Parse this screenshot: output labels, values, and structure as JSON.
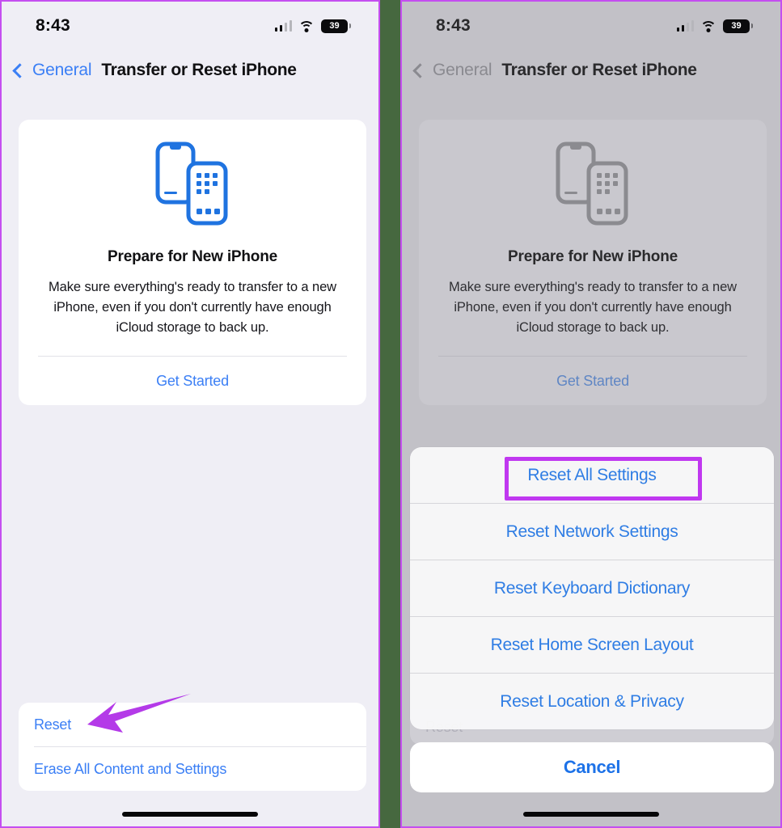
{
  "meta": {
    "accent_blue": "#3b7ff5",
    "annotation_purple": "#c038f0",
    "panel_bg": "#efeef5",
    "panel_bg_dimmed": "#c2c1c7",
    "gutter_green": "#46683f"
  },
  "status_bar": {
    "time": "8:43",
    "battery_percent": "39",
    "cellular_icon": "cellular-bars-icon",
    "wifi_icon": "wifi-icon",
    "battery_icon": "battery-icon"
  },
  "nav": {
    "back_icon": "chevron-left-icon",
    "back_label": "General",
    "title": "Transfer or Reset iPhone"
  },
  "prepare_card": {
    "icon": "two-phones-transfer-icon",
    "title": "Prepare for New iPhone",
    "description": "Make sure everything's ready to transfer to a new iPhone, even if you don't currently have enough iCloud storage to back up.",
    "action_label": "Get Started"
  },
  "bottom_list": {
    "items": [
      {
        "label": "Reset"
      },
      {
        "label": "Erase All Content and Settings"
      }
    ]
  },
  "action_sheet": {
    "items": [
      {
        "label": "Reset All Settings",
        "highlighted": true
      },
      {
        "label": "Reset Network Settings",
        "highlighted": false
      },
      {
        "label": "Reset Keyboard Dictionary",
        "highlighted": false
      },
      {
        "label": "Reset Home Screen Layout",
        "highlighted": false
      },
      {
        "label": "Reset Location & Privacy",
        "highlighted": false
      }
    ],
    "cancel_label": "Cancel",
    "ghost_label": "Reset"
  },
  "annotations": {
    "arrow_target": "Reset",
    "highlight_target": "Reset All Settings"
  }
}
